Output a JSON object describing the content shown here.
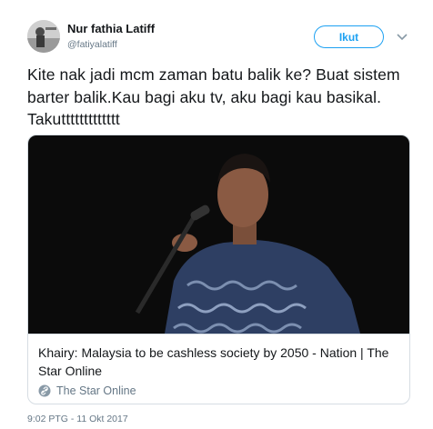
{
  "author": {
    "name": "Nur fathia Latiff",
    "handle": "@fatiyalatiff"
  },
  "follow_button": {
    "label": "Ikut"
  },
  "tweet": {
    "text": "Kite nak jadi mcm zaman batu balik ke? Buat sistem barter balik.Kau bagi aku tv, aku bagi kau basikal. Takuttttttttttttt"
  },
  "card": {
    "title": "Khairy: Malaysia to be cashless society by 2050 - Nation | The Star Online",
    "source": "The Star Online",
    "source_icon": "link-icon"
  },
  "timestamp": "9:02 PTG - 11 Okt 2017",
  "colors": {
    "accent": "#1da1f2",
    "text": "#14171a",
    "muted": "#657786",
    "border": "#d6dde3"
  }
}
